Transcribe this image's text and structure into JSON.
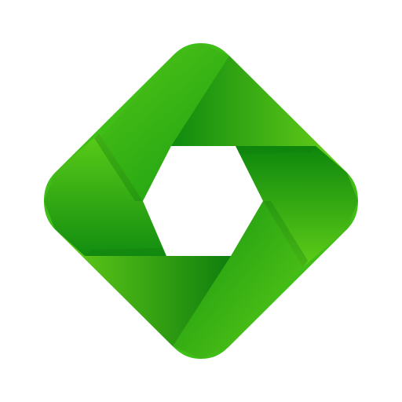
{
  "app_icon": {
    "name": "camera-shutter-app-icon",
    "background_color": "#ffffff",
    "shape": "rounded-diamond",
    "aperture_blades": 6,
    "colors": {
      "light_green": "#6fd11a",
      "mid_green": "#3fbe17",
      "dark_green": "#138e10",
      "deep_shadow": "#0f6e0c",
      "center_hole": "#ffffff"
    }
  }
}
